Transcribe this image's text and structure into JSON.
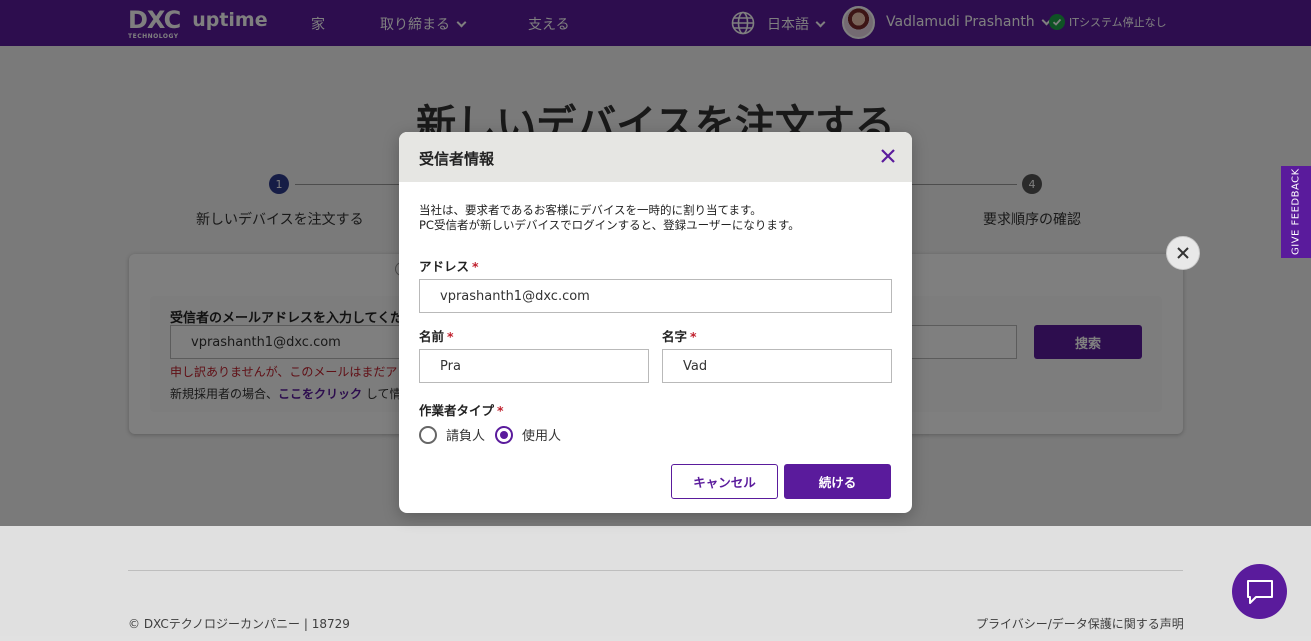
{
  "header": {
    "logo_text": "DXC",
    "logo_subtext": "TECHNOLOGY",
    "product": "uptime",
    "nav": [
      {
        "label": "家"
      },
      {
        "label": "取り締まる"
      },
      {
        "label": "支える"
      }
    ],
    "language": "日本語",
    "user_name": "Vadlamudi Prashanth",
    "status_text": "ITシステム停止なし"
  },
  "page": {
    "title": "新しいデバイスを注文する",
    "steps": [
      {
        "number": "1",
        "label": "新しいデバイスを注文する"
      },
      {
        "number": "4",
        "label": "要求順序の確認"
      }
    ],
    "recipient_email_label": "受信者のメールアドレスを入力してくださ",
    "recipient_email_value": "vprashanth1@dxc.com",
    "search_button": "搜索",
    "error_text": "申し訳ありませんが、このメールはまだア",
    "hint_prefix": "新規採用者の場合、",
    "hint_link": "ここをクリック",
    "hint_suffix": " して情"
  },
  "feedback_tab": "GIVE FEEDBACK",
  "footer": {
    "copyright": "© DXCテクノロジーカンパニー | 18729",
    "privacy": "プライバシー/データ保護に関する声明"
  },
  "modal": {
    "title": "受信者情報",
    "description_line1": "当社は、要求者であるお客様にデバイスを一時的に割り当てます。",
    "description_line2": "PC受信者が新しいデバイスでログインすると、登録ユーザーになります。",
    "address_label": "アドレス",
    "address_value": "vprashanth1@dxc.com",
    "first_name_label": "名前",
    "first_name_value": "Pra",
    "last_name_label": "名字",
    "last_name_value": "Vad",
    "worker_type_label": "作業者タイプ",
    "required_mark": "*",
    "options": [
      {
        "label": "請負人",
        "selected": false
      },
      {
        "label": "使用人",
        "selected": true
      }
    ],
    "cancel_button": "キャンセル",
    "continue_button": "続ける"
  },
  "colors": {
    "brand": "#5a1b9c",
    "error": "#c0202d",
    "status_ok": "#1fa44a"
  }
}
